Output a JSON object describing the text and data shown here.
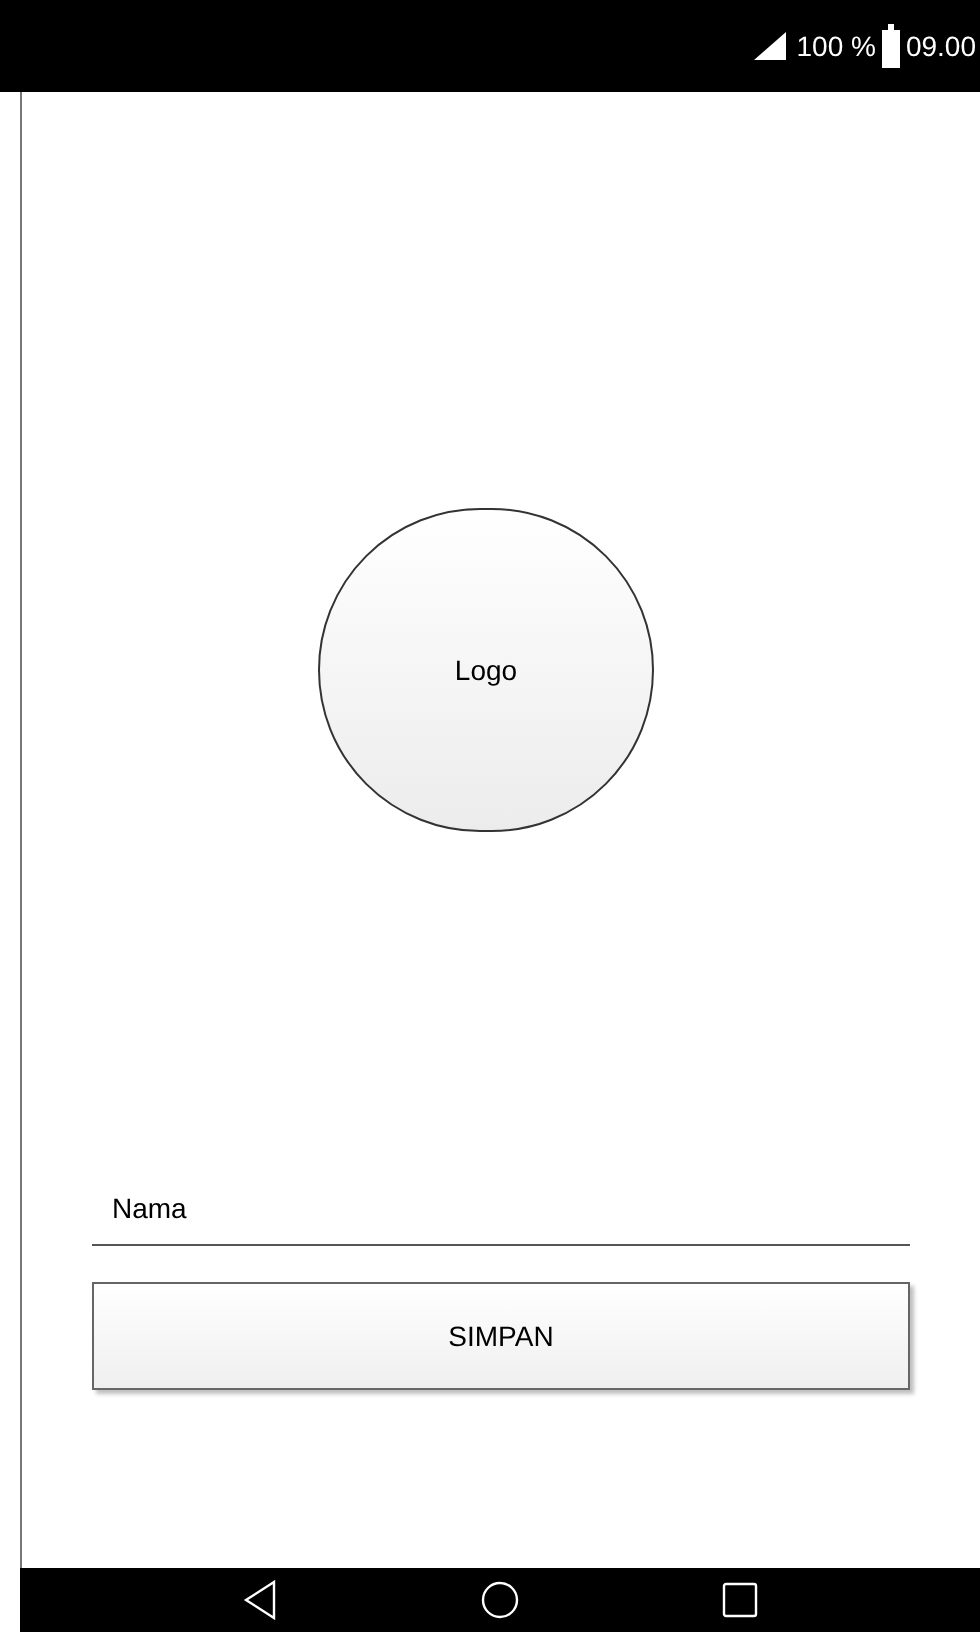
{
  "status_bar": {
    "battery": "100 %",
    "time": "09.00"
  },
  "logo": {
    "label": "Logo"
  },
  "name_field": {
    "placeholder": "Nama"
  },
  "save_button": {
    "label": "SIMPAN"
  }
}
